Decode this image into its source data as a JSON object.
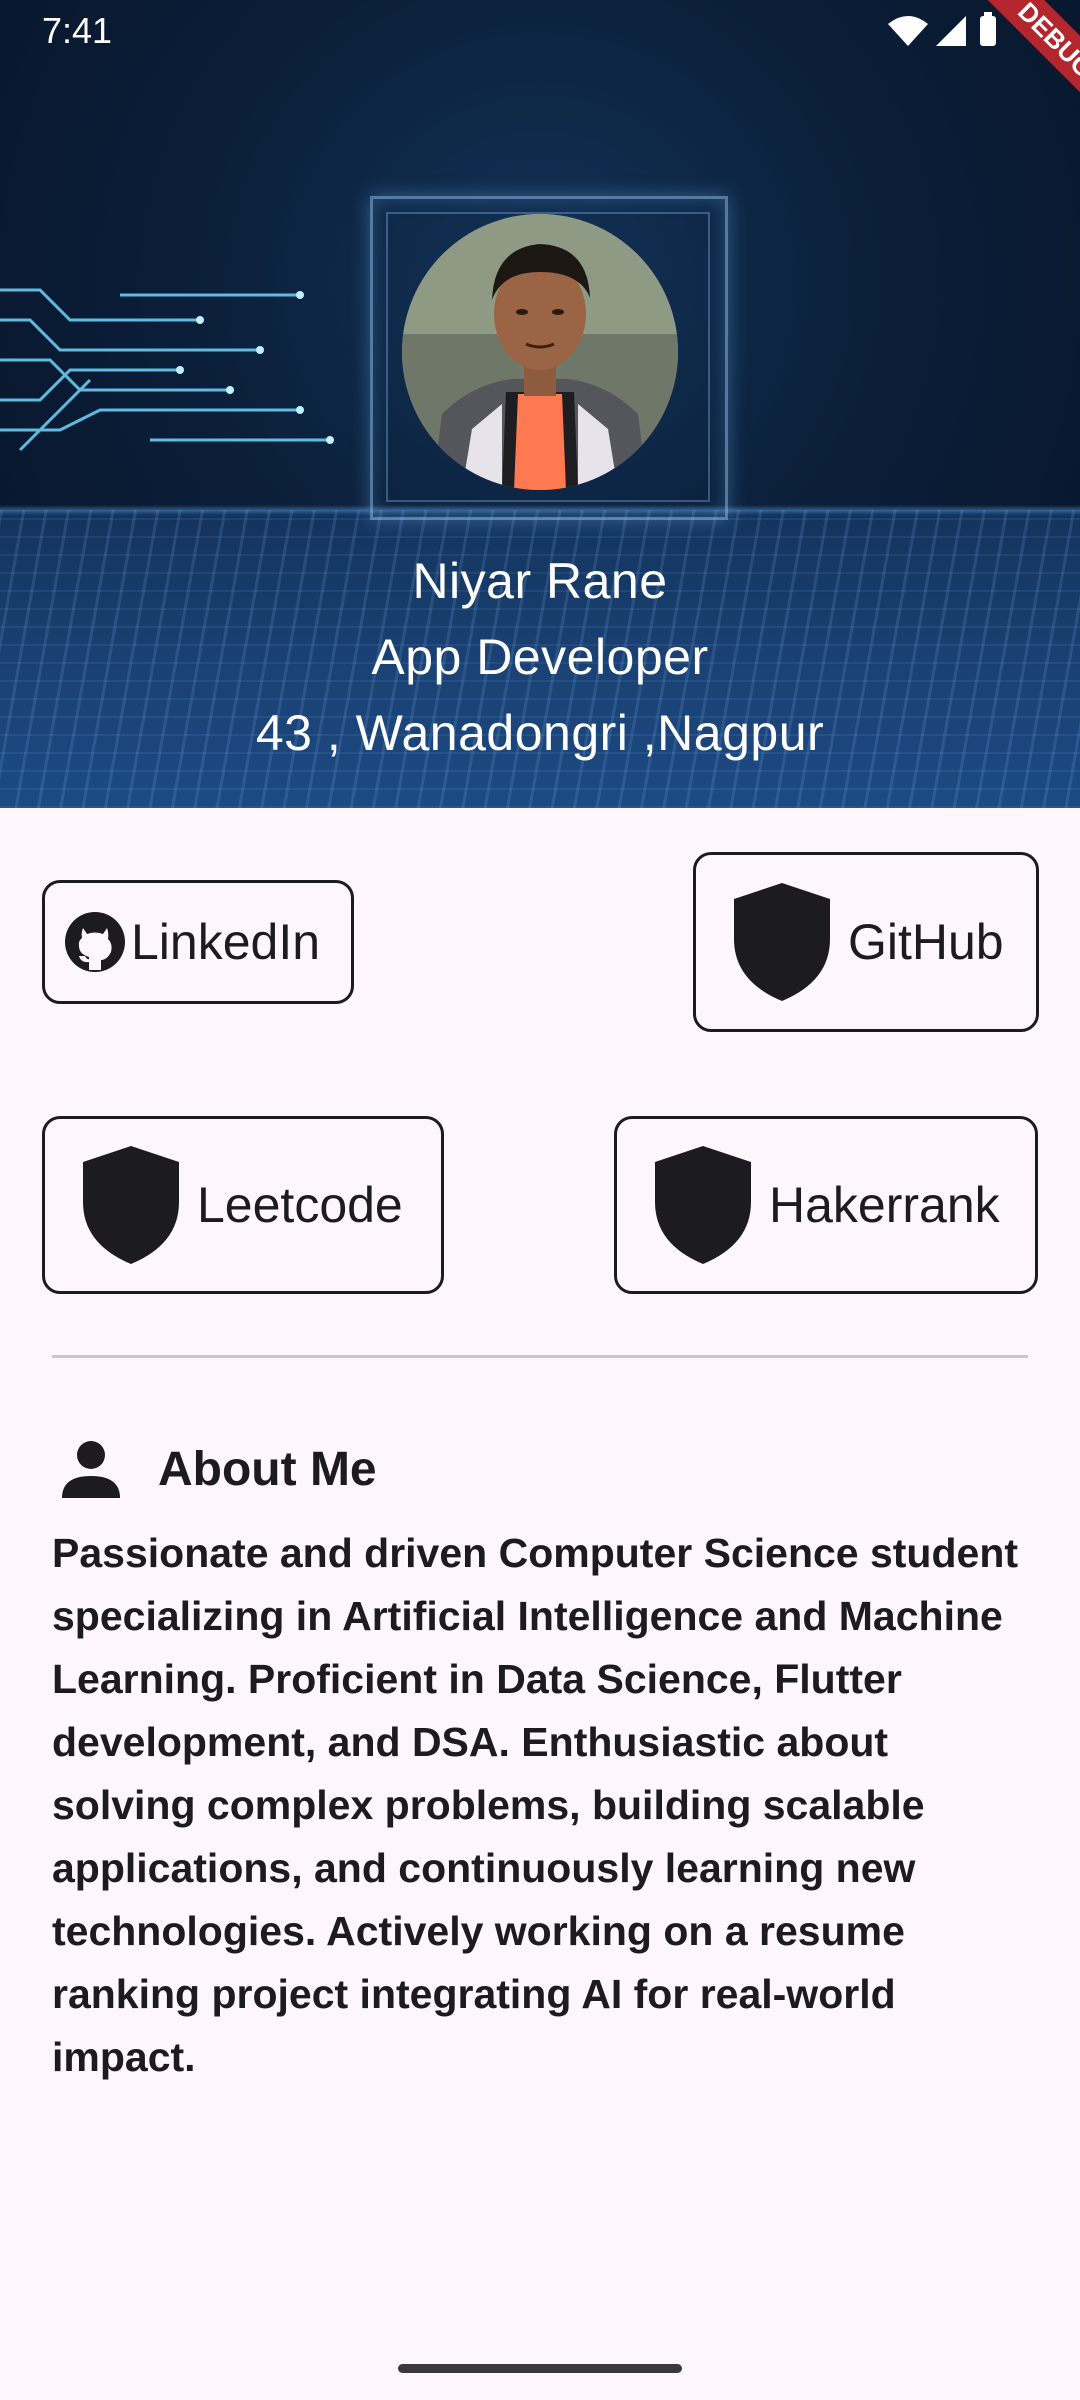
{
  "status_bar": {
    "time": "7:41",
    "debug_label": "DEBUG"
  },
  "header": {
    "name": "Niyar Rane",
    "role": "App Developer",
    "address": "43 , Wanadongri ,Nagpur"
  },
  "links": {
    "linkedin": {
      "label": "LinkedIn",
      "icon": "github-icon"
    },
    "github": {
      "label": "GitHub",
      "icon": "shield-icon"
    },
    "leetcode": {
      "label": "Leetcode",
      "icon": "shield-icon"
    },
    "hackerrank": {
      "label": "Hakerrank",
      "icon": "shield-icon"
    }
  },
  "about": {
    "title": "About Me",
    "icon": "person-icon",
    "body": "Passionate and driven Computer Science student specializing in Artificial Intelligence and Machine Learning. Proficient in Data Science, Flutter development, and DSA. Enthusiastic about solving complex problems, building scalable applications, and continuously learning new technologies. Actively working on a resume ranking project integrating AI for real-world impact."
  },
  "colors": {
    "background": "#FDF7FC",
    "text": "#1c1b1f",
    "hero_dark": "#061326",
    "hero_light": "#1d4d86",
    "debug_banner": "#b3262e"
  }
}
